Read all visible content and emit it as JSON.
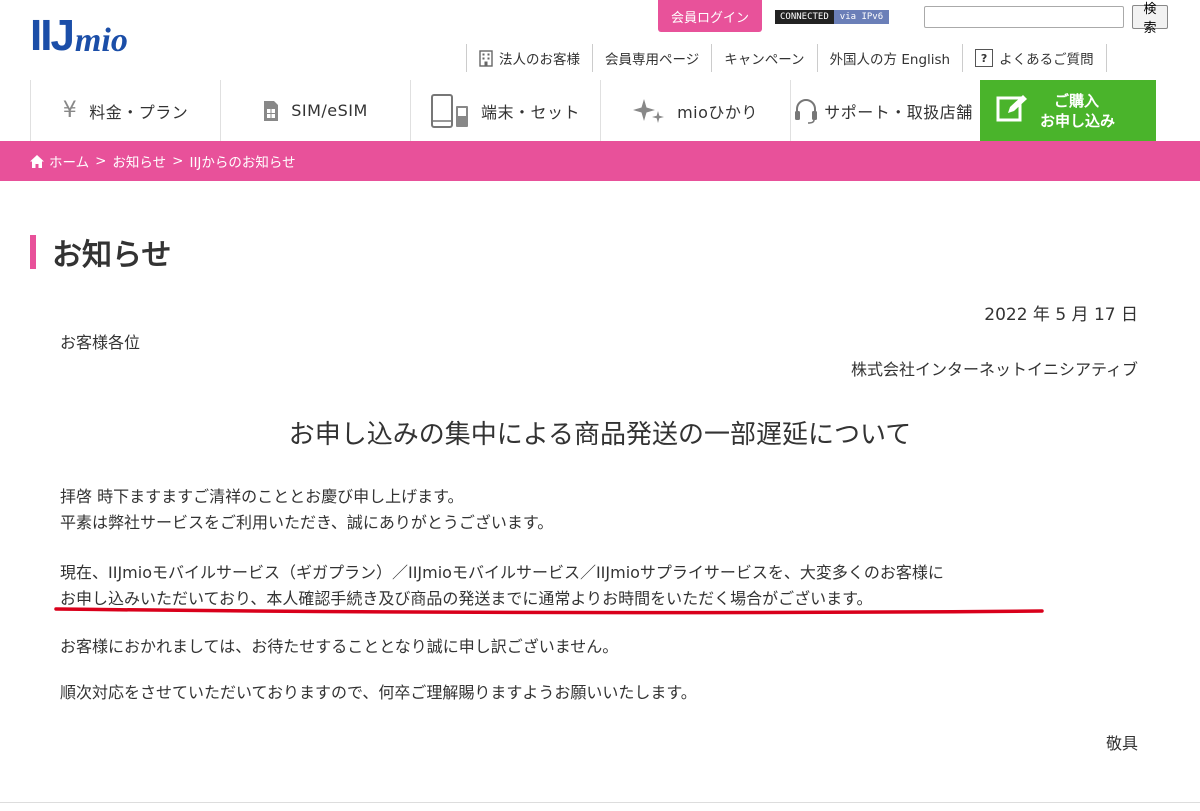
{
  "header": {
    "logo_iij": "IIJ",
    "logo_mio": "mio",
    "login_label": "会員ログイン",
    "connected_label": "CONNECTED",
    "ipv6_label": "via IPv6",
    "search_button": "検索",
    "util_links": [
      {
        "label": "法人のお客様",
        "icon": "building-icon"
      },
      {
        "label": "会員専用ページ"
      },
      {
        "label": "キャンペーン"
      },
      {
        "label": "外国人の方 English"
      },
      {
        "label": "よくあるご質問",
        "icon": "question-icon",
        "icon_text": "?"
      }
    ]
  },
  "nav": {
    "items": [
      {
        "label": "料金・プラン",
        "icon": "yen-icon",
        "icon_text": "¥"
      },
      {
        "label": "SIM/eSIM",
        "icon": "sim-card-icon"
      },
      {
        "label": "端末・セット",
        "icon": "devices-icon"
      },
      {
        "label": "mioひかり",
        "icon": "sparkle-icon"
      },
      {
        "label": "サポート・取扱店舗",
        "icon": "headset-icon"
      }
    ],
    "cta_line1": "ご購入",
    "cta_line2": "お申し込み"
  },
  "breadcrumb": {
    "home": "ホーム",
    "sep": ">",
    "level1": "お知らせ",
    "level2": "IIJからのお知らせ"
  },
  "content": {
    "page_title": "お知らせ",
    "date": "2022 年 5 月 17 日",
    "addressee": "お客様各位",
    "company": "株式会社インターネットイニシアティブ",
    "headline": "お申し込みの集中による商品発送の一部遅延について",
    "p1_line1": "拝啓 時下ますますご清祥のこととお慶び申し上げます。",
    "p1_line2": "平素は弊社サービスをご利用いただき、誠にありがとうございます。",
    "p2_line1": "現在、IIJmioモバイルサービス（ギガプラン）／IIJmioモバイルサービス／IIJmioサプライサービスを、大変多くのお客様に",
    "p2_line2": "お申し込みいただいており、本人確認手続き及び商品の発送までに通常よりお時間をいただく場合がございます。",
    "p3": "お客様におかれましては、お待たせすることとなり誠に申し訳ございません。",
    "p4": "順次対応をさせていただいておりますので、何卒ご理解賜りますようお願いいたします。",
    "closing": "敬具"
  },
  "colors": {
    "brand_blue": "#1b4ea8",
    "accent_pink": "#e8519a",
    "cta_green": "#4ab42b",
    "underline_red": "#d9001b"
  }
}
